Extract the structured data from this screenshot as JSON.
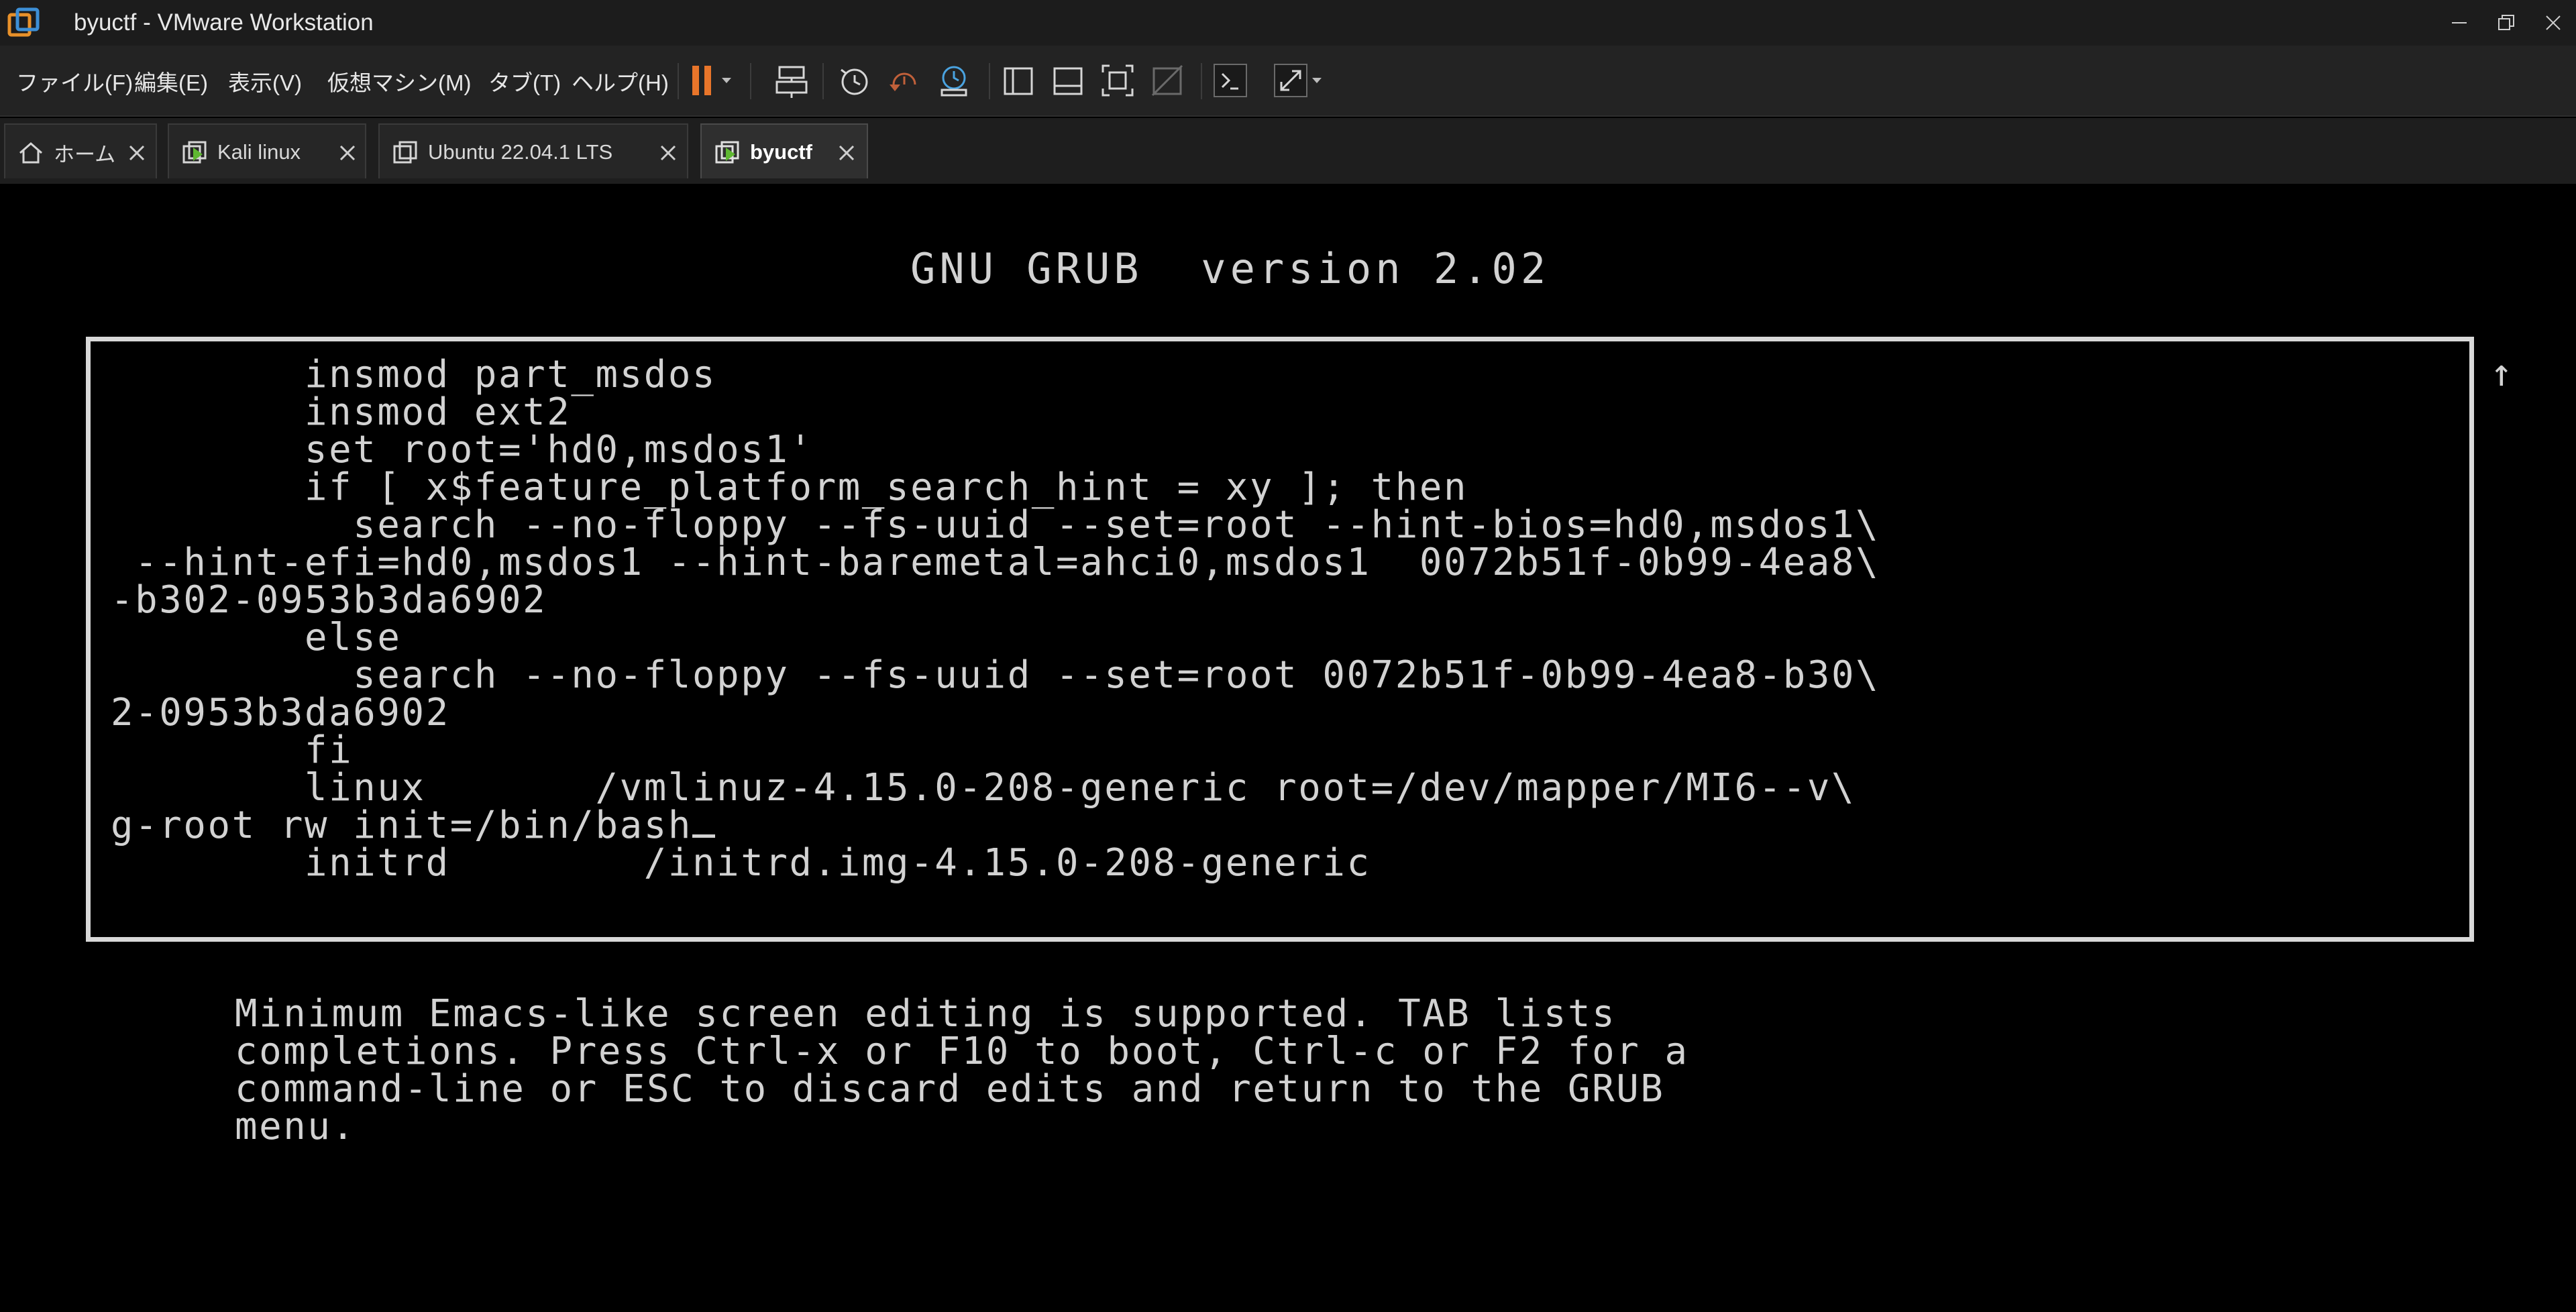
{
  "window": {
    "title": "byuctf - VMware Workstation"
  },
  "menu": {
    "items": [
      "ファイル(F)",
      "編集(E)",
      "表示(V)",
      "仮想マシン(M)",
      "タブ(T)",
      "ヘルプ(H)"
    ]
  },
  "tabs": [
    {
      "label": "ホーム",
      "icon": "home-icon",
      "active": false
    },
    {
      "label": "Kali linux",
      "icon": "vm-running-icon",
      "active": false
    },
    {
      "label": "Ubuntu 22.04.1 LTS",
      "icon": "vm-icon",
      "active": false
    },
    {
      "label": "byuctf",
      "icon": "vm-running-icon",
      "active": true
    }
  ],
  "colors": {
    "pause_accent": "#e8752a",
    "running_green": "#5fb832",
    "titlebar_bg": "#1c1c1c",
    "console_text": "#d2d2d2"
  },
  "console": {
    "grub_title": "GNU GRUB  version 2.02",
    "scroll_arrow": "↑",
    "lines": [
      "        insmod part_msdos",
      "        insmod ext2",
      "        set root='hd0,msdos1'",
      "        if [ x$feature_platform_search_hint = xy ]; then",
      "          search --no-floppy --fs-uuid --set=root --hint-bios=hd0,msdos1\\",
      " --hint-efi=hd0,msdos1 --hint-baremetal=ahci0,msdos1  0072b51f-0b99-4ea8\\",
      "-b302-0953b3da6902",
      "        else",
      "          search --no-floppy --fs-uuid --set=root 0072b51f-0b99-4ea8-b30\\",
      "2-0953b3da6902",
      "        fi",
      "        linux       /vmlinuz-4.15.0-208-generic root=/dev/mapper/MI6--v\\",
      "g-root rw init=/bin/bash",
      "        initrd        /initrd.img-4.15.0-208-generic"
    ],
    "help": [
      "Minimum Emacs-like screen editing is supported. TAB lists",
      "completions. Press Ctrl-x or F10 to boot, Ctrl-c or F2 for a",
      "command-line or ESC to discard edits and return to the GRUB",
      "menu."
    ]
  }
}
